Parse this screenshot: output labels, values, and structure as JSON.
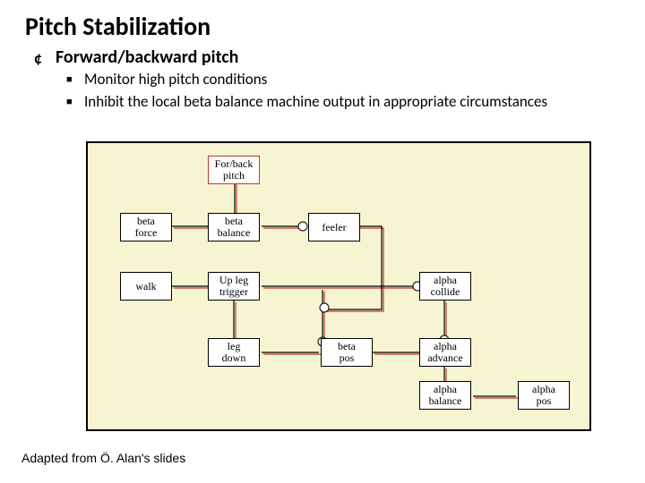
{
  "title": "Pitch Stabilization",
  "subheading": "Forward/backward pitch",
  "bullets": {
    "b1": "Monitor high pitch conditions",
    "b2": "Inhibit the local beta balance machine output in appropriate circumstances"
  },
  "nodes": {
    "for_back_pitch": "For/back\npitch",
    "beta_force": "beta\nforce",
    "beta_balance": "beta\nbalance",
    "feeler": "feeler",
    "walk": "walk",
    "up_leg_trigger": "Up leg\ntrigger",
    "alpha_collide": "alpha\ncollide",
    "leg_down": "leg\ndown",
    "beta_pos": "beta\npos",
    "alpha_advance": "alpha\nadvance",
    "alpha_balance": "alpha\nbalance",
    "alpha_pos": "alpha\npos"
  },
  "credit": "Adapted from Ö. Alan's slides",
  "chart_data": {
    "type": "diagram",
    "title": "Pitch Stabilization — subsumption-style block diagram",
    "blocks": [
      "For/back pitch",
      "beta force",
      "beta balance",
      "feeler",
      "walk",
      "Up leg trigger",
      "alpha collide",
      "leg down",
      "beta pos",
      "alpha advance",
      "alpha balance",
      "alpha pos"
    ],
    "edges": [
      {
        "from": "For/back pitch",
        "to": "beta balance",
        "kind": "inhibit"
      },
      {
        "from": "beta force",
        "to": "beta balance"
      },
      {
        "from": "beta balance",
        "to": "feeler",
        "kind": "inhibit"
      },
      {
        "from": "feeler",
        "to": "down-right"
      },
      {
        "from": "walk",
        "to": "Up leg trigger"
      },
      {
        "from": "Up leg trigger",
        "to": "alpha collide",
        "kind": "inhibit"
      },
      {
        "from": "Up leg trigger",
        "to": "leg down"
      },
      {
        "from": "Up leg trigger",
        "to": "beta pos",
        "kind": "suppress"
      },
      {
        "from": "leg down",
        "to": "beta pos",
        "kind": "suppress"
      },
      {
        "from": "beta pos",
        "to": "alpha advance",
        "kind": "inhibit"
      },
      {
        "from": "alpha collide",
        "to": "alpha advance",
        "kind": "inhibit"
      },
      {
        "from": "alpha advance",
        "to": "alpha balance"
      },
      {
        "from": "alpha balance",
        "to": "alpha pos"
      }
    ],
    "highlighted_block": "For/back pitch"
  }
}
